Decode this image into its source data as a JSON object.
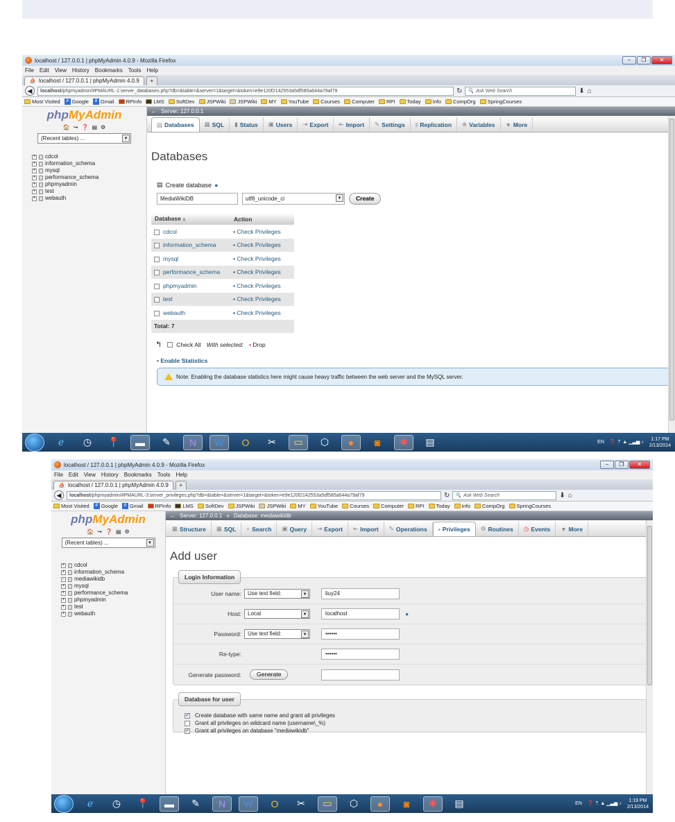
{
  "screen1": {
    "window_title": "localhost / 127.0.0.1 | phpMyAdmin 4.0.9 - Mozilla Firefox",
    "menu": [
      "File",
      "Edit",
      "View",
      "History",
      "Bookmarks",
      "Tools",
      "Help"
    ],
    "tab_label": "localhost / 127.0.0.1 | phpMyAdmin 4.0.9",
    "new_tab": "+",
    "url_host": "localhost",
    "url_path": "/phpmyadmin/#PMAURL-1:server_databases.php?db=&table=&server=1&target=&token=e9e120f2142553a5df585a644a79af79",
    "search_placeholder": "Ask Web Search",
    "bookmarks": [
      "Most Visited",
      "Google",
      "Gmail",
      "RPInfo",
      "LMS",
      "SoftDev",
      "JSPWiki",
      "JSPWiki",
      "MY",
      "YouTube",
      "Courses",
      "Computer",
      "RPI",
      "Today",
      "Info",
      "CompOrg",
      "SpringCourses"
    ],
    "logo_a": "php",
    "logo_b": "MyAdmin",
    "recent": "(Recent tables) ...",
    "tree": [
      "cdcol",
      "information_schema",
      "mysql",
      "performance_schema",
      "phpmyadmin",
      "test",
      "webauth"
    ],
    "breadcrumb": "Server: 127.0.0.1",
    "top_menu": [
      "Databases",
      "SQL",
      "Status",
      "Users",
      "Export",
      "Import",
      "Settings",
      "Replication",
      "Variables",
      "More"
    ],
    "heading": "Databases",
    "create_label": "Create database",
    "db_name_value": "MediaWikiDB",
    "collation_value": "utf8_unicode_ci",
    "create_button": "Create",
    "table_headers": [
      "Database",
      "Action"
    ],
    "rows": [
      {
        "db": "cdcol",
        "action": "Check Privileges"
      },
      {
        "db": "information_schema",
        "action": "Check Privileges"
      },
      {
        "db": "mysql",
        "action": "Check Privileges"
      },
      {
        "db": "performance_schema",
        "action": "Check Privileges"
      },
      {
        "db": "phpmyadmin",
        "action": "Check Privileges"
      },
      {
        "db": "test",
        "action": "Check Privileges"
      },
      {
        "db": "webauth",
        "action": "Check Privileges"
      }
    ],
    "total": "Total: 7",
    "check_all": "Check All",
    "with_selected": "With selected:",
    "drop": "Drop",
    "enable_stats": "Enable Statistics",
    "note": "Note: Enabling the database statistics here might cause heavy traffic between the web server and the MySQL server.",
    "lang": "EN",
    "time": "1:17 PM",
    "date": "2/13/2014"
  },
  "screen2": {
    "window_title": "localhost / 127.0.0.1 | phpMyAdmin 4.0.9 - Mozilla Firefox",
    "tab_label": "localhost / 127.0.0.1 | phpMyAdmin 4.0.9",
    "url_host": "localhost",
    "url_path": "/phpmyadmin/#PMAURL-3:server_privileges.php?db=&table=&server=1&target=&token=e9e120f2142553a5df585a644a79af79",
    "tree": [
      "cdcol",
      "information_schema",
      "mediawikidb",
      "mysql",
      "performance_schema",
      "phpmyadmin",
      "test",
      "webauth"
    ],
    "breadcrumb_a": "Server: 127.0.0.1",
    "breadcrumb_b": "Database: mediawikidb",
    "top_menu": [
      "Structure",
      "SQL",
      "Search",
      "Query",
      "Export",
      "Import",
      "Operations",
      "Privileges",
      "Routines",
      "Events",
      "More"
    ],
    "heading": "Add user",
    "login_legend": "Login Information",
    "fields": [
      {
        "label": "User name:",
        "select": "Use text field:",
        "value": "liuy24"
      },
      {
        "label": "Host:",
        "select": "Local",
        "value": "localhost"
      },
      {
        "label": "Password:",
        "select": "Use text field:",
        "value": "••••••"
      },
      {
        "label": "Re-type:",
        "select": "",
        "value": "••••••"
      },
      {
        "label": "Generate password:",
        "select": "",
        "value": ""
      }
    ],
    "generate_button": "Generate",
    "db_legend": "Database for user",
    "options": [
      {
        "label": "Create database with same name and grant all privileges",
        "checked": true
      },
      {
        "label": "Grant all privileges on wildcard name (username\\_%)",
        "checked": false
      },
      {
        "label": "Grant all privileges on database \"mediawikidb\"",
        "checked": true
      }
    ],
    "lang": "EN",
    "time": "1:19 PM",
    "date": "2/13/2014"
  }
}
